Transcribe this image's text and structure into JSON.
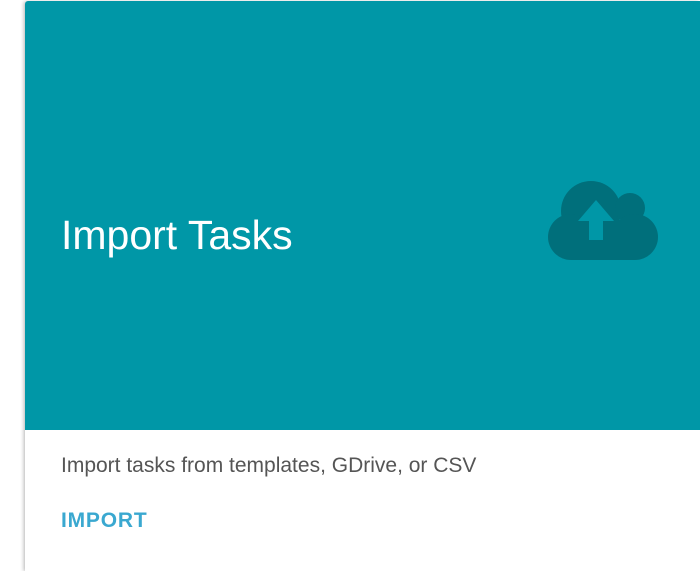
{
  "card": {
    "title": "Import Tasks",
    "description": "Import tasks from templates, GDrive, or CSV",
    "action_label": "IMPORT",
    "icon": "cloud-upload-icon"
  },
  "colors": {
    "header_background": "#0097a7",
    "icon": "#006f7b",
    "title": "#ffffff",
    "description": "#555555",
    "action": "#3aa8d0"
  }
}
